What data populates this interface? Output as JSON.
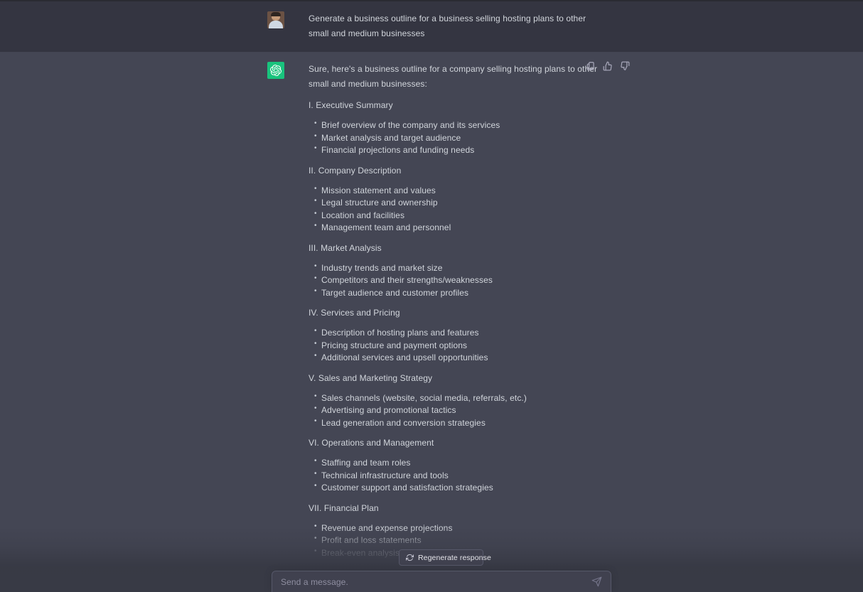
{
  "theme": {
    "user_row_bg": "#343541",
    "assistant_row_bg": "#444654",
    "accent_green": "#19c37d",
    "text_color": "#d1d5db",
    "muted_text": "#8e8ea0"
  },
  "conversation": {
    "user_message": {
      "avatar_name": "user-photo-avatar",
      "text": "Generate a business outline for a  business selling hosting plans to other small and medium businesses"
    },
    "assistant_message": {
      "avatar_name": "openai-logo-avatar",
      "intro": "Sure, here's a business outline for a company selling hosting plans to other small and medium businesses:",
      "actions": [
        {
          "name": "copy-icon",
          "label": "Copy"
        },
        {
          "name": "thumbs-up-icon",
          "label": "Good response"
        },
        {
          "name": "thumbs-down-icon",
          "label": "Bad response"
        }
      ],
      "sections": [
        {
          "heading": "I. Executive Summary",
          "bullets": [
            "Brief overview of the company and its services",
            "Market analysis and target audience",
            "Financial projections and funding needs"
          ]
        },
        {
          "heading": "II. Company Description",
          "bullets": [
            "Mission statement and values",
            "Legal structure and ownership",
            "Location and facilities",
            "Management team and personnel"
          ]
        },
        {
          "heading": "III. Market Analysis",
          "bullets": [
            "Industry trends and market size",
            "Competitors and their strengths/weaknesses",
            "Target audience and customer profiles"
          ]
        },
        {
          "heading": "IV. Services and Pricing",
          "bullets": [
            "Description of hosting plans and features",
            "Pricing structure and payment options",
            "Additional services and upsell opportunities"
          ]
        },
        {
          "heading": "V. Sales and Marketing Strategy",
          "bullets": [
            "Sales channels (website, social media, referrals, etc.)",
            "Advertising and promotional tactics",
            "Lead generation and conversion strategies"
          ]
        },
        {
          "heading": "VI. Operations and Management",
          "bullets": [
            "Staffing and team roles",
            "Technical infrastructure and tools",
            "Customer support and satisfaction strategies"
          ]
        },
        {
          "heading": "VII. Financial Plan",
          "bullets": [
            "Revenue and expense projections",
            "Profit and loss statements",
            "Break-even analysis"
          ]
        }
      ]
    }
  },
  "bullet_glyph": "•",
  "regenerate": {
    "label": "Regenerate response",
    "icon": "refresh-icon"
  },
  "composer": {
    "placeholder": "Send a message.",
    "value": "",
    "send_icon": "send-paper-plane-icon"
  }
}
